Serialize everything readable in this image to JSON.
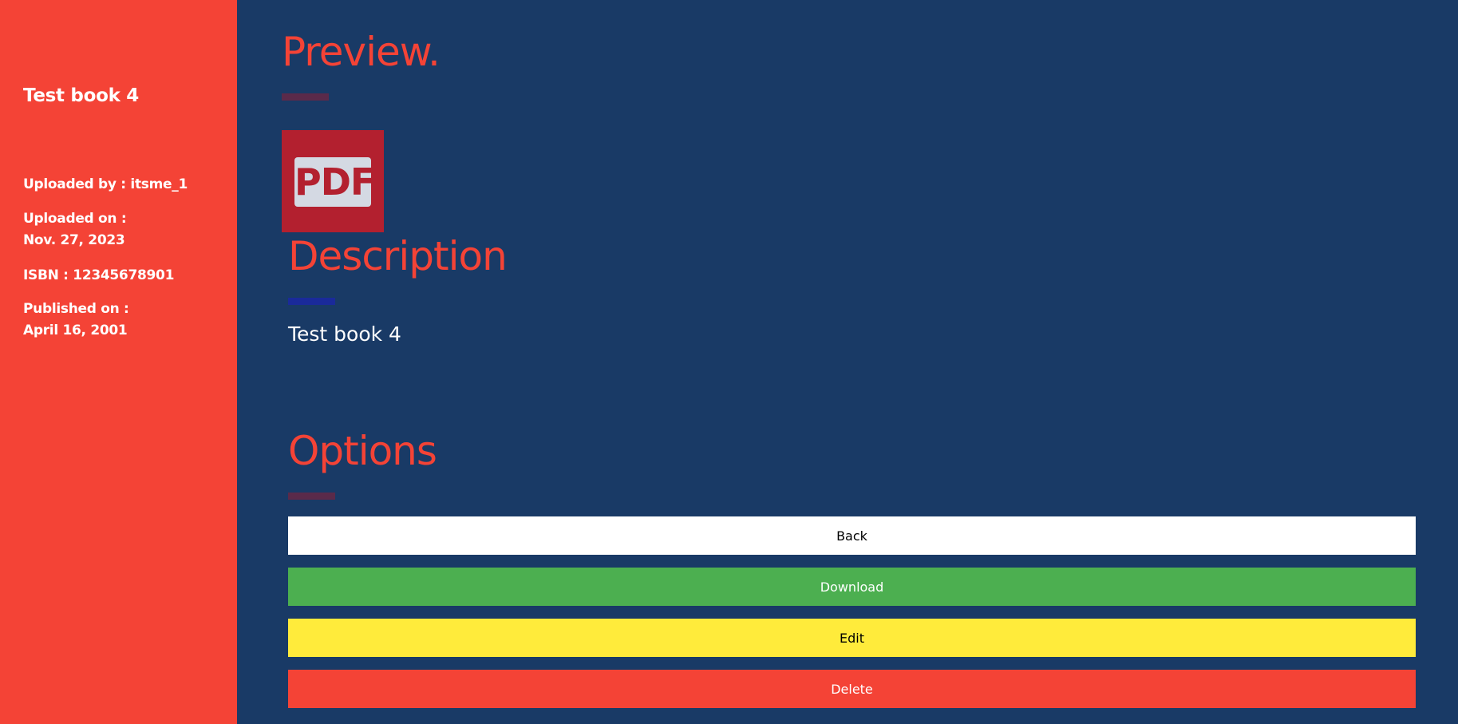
{
  "sidebar": {
    "title": "Test book 4",
    "uploaded_by": "Uploaded by : itsme_1",
    "uploaded_on_label": "Uploaded on :",
    "uploaded_on_value": "Nov. 27, 2023",
    "isbn": "ISBN : 12345678901",
    "published_on_label": "Published on :",
    "published_on_value": "April 16, 2001"
  },
  "preview": {
    "heading": "Preview.",
    "thumbnail_label": "PDF",
    "icon": "pdf-icon"
  },
  "description": {
    "heading": "Description",
    "text": "Test book 4"
  },
  "options": {
    "heading": "Options",
    "buttons": [
      {
        "label": "Back",
        "bg": "#ffffff",
        "fg": "#000000"
      },
      {
        "label": "Download",
        "bg": "#4caf50",
        "fg": "#ffffff"
      },
      {
        "label": "Edit",
        "bg": "#ffeb3b",
        "fg": "#000000"
      },
      {
        "label": "Delete",
        "bg": "#f44336",
        "fg": "#ffffff"
      }
    ]
  },
  "colors": {
    "sidebar_bg": "#f44336",
    "main_bg": "#193a66",
    "accent": "#f44336",
    "underline_preview": "#5a2a4a",
    "underline_description": "#1a2a9a",
    "underline_options": "#5a2a4a"
  }
}
